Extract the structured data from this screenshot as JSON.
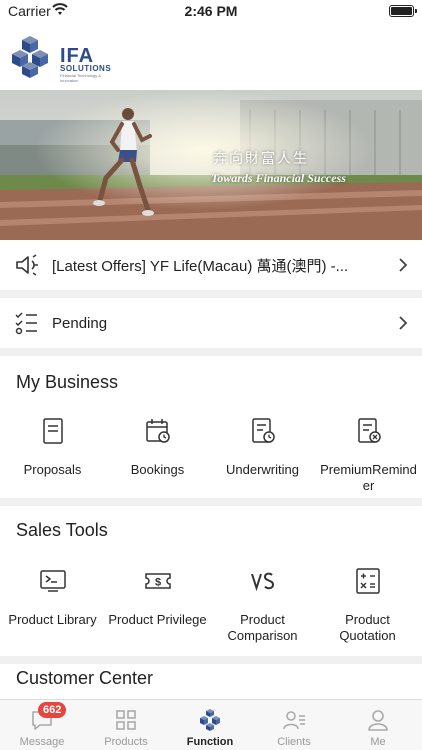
{
  "status_bar": {
    "carrier": "Carrier",
    "time": "2:46 PM"
  },
  "header": {
    "logo_word": "IFA",
    "logo_sub": "SOLUTIONS",
    "logo_tagline": "Financial Technology & Innovation"
  },
  "banner": {
    "title_cn": "奔向財富人生",
    "title_en": "Towards Financial Success"
  },
  "offer": {
    "text": "[Latest Offers]  YF Life(Macau) 萬通(澳門) -..."
  },
  "pending": {
    "label": "Pending"
  },
  "my_business": {
    "title": "My Business",
    "items": [
      {
        "label": "Proposals"
      },
      {
        "label": "Bookings"
      },
      {
        "label": "Underwriting"
      },
      {
        "label1": "PremiumRemind",
        "label2": "er"
      }
    ]
  },
  "sales_tools": {
    "title": "Sales Tools",
    "items": [
      {
        "label1": "Product Library",
        "label2": ""
      },
      {
        "label1": "Product Privilege",
        "label2": ""
      },
      {
        "label1": "Product",
        "label2": "Comparison"
      },
      {
        "label1": "Product",
        "label2": "Quotation"
      }
    ]
  },
  "customer_center": {
    "title": "Customer Center"
  },
  "tabbar": {
    "badge": "662",
    "tabs": [
      {
        "label": "Message"
      },
      {
        "label": "Products"
      },
      {
        "label": "Function"
      },
      {
        "label": "Clients"
      },
      {
        "label": "Me"
      }
    ]
  },
  "colors": {
    "brand": "#2d4a8a",
    "badge": "#e5463f",
    "icon": "#333333"
  }
}
